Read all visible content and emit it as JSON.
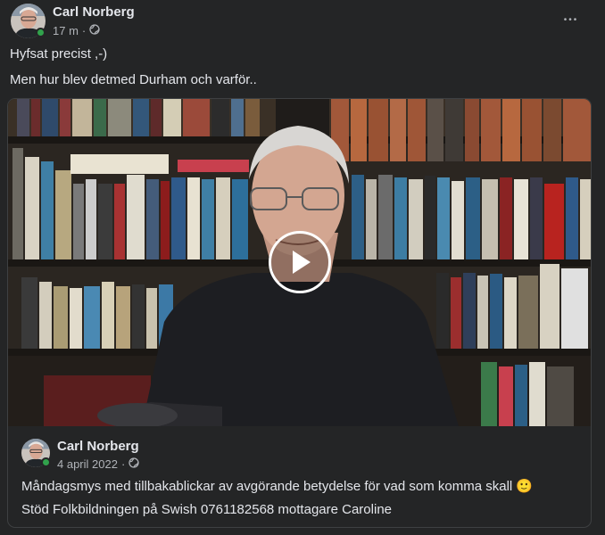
{
  "post": {
    "author": "Carl Norberg",
    "time": "17 m",
    "separator": "·",
    "privacy_icon": "globe-icon",
    "more_label": "•••",
    "lines": [
      "Hyfsat precist ,-)",
      "Men hur blev detmed Durham och varför.."
    ]
  },
  "shared": {
    "author": "Carl Norberg",
    "date": "4 april 2022",
    "separator": "·",
    "privacy_icon": "globe-icon",
    "lines": [
      "Måndagsmys med tillbakablickar av avgörande betydelse för vad som komma skall 🙂",
      "Stöd Folkbildningen på Swish 0761182568 mottagare Caroline"
    ],
    "video_play_icon": "play-icon"
  },
  "colors": {
    "background": "#242526",
    "text": "#e4e6eb",
    "secondary_text": "#b0b3b8",
    "online": "#31a24c"
  }
}
